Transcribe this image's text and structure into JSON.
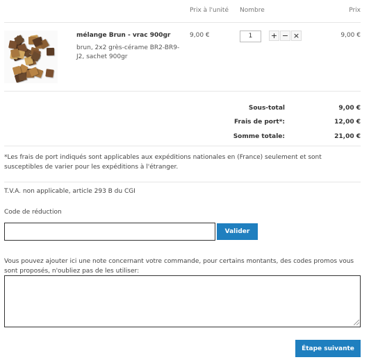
{
  "table": {
    "col_unit_price": "Prix à l'unité",
    "col_quantity": "Nombre",
    "col_price": "Prix"
  },
  "item": {
    "name": "mélange Brun - vrac 900gr",
    "description": "brun, 2x2 grès-cérame BR2-BR9-J2, sachet 900gr",
    "unit_price": "9,00 €",
    "quantity": "1",
    "price": "9,00 €",
    "image_icon": "mosaic-tiles-product-image"
  },
  "totals": {
    "subtotal_label": "Sous-total",
    "subtotal_value": "9,00 €",
    "shipping_label": "Frais de port*:",
    "shipping_value": "12,00 €",
    "total_label": "Somme totale:",
    "total_value": "21,00 €"
  },
  "notes": {
    "shipping_note": "*Les frais de port indiqués sont applicables aux expéditions nationales en (France) seulement et sont susceptibles de varier pour les expéditions à l'étranger.",
    "vat_note": "T.V.A. non applicable, article 293 B du CGI"
  },
  "discount": {
    "label": "Code de réduction",
    "value": "",
    "button": "Valider"
  },
  "comment": {
    "label": "Vous pouvez ajouter ici une note concernant votre commande, pour certains montants, des codes promos vous sont proposés, n'oubliez pas de les utiliser:",
    "value": ""
  },
  "next_button": "Étape suivante",
  "colors": {
    "primary": "#1f7fbf",
    "divider": "#e6e6e6"
  }
}
